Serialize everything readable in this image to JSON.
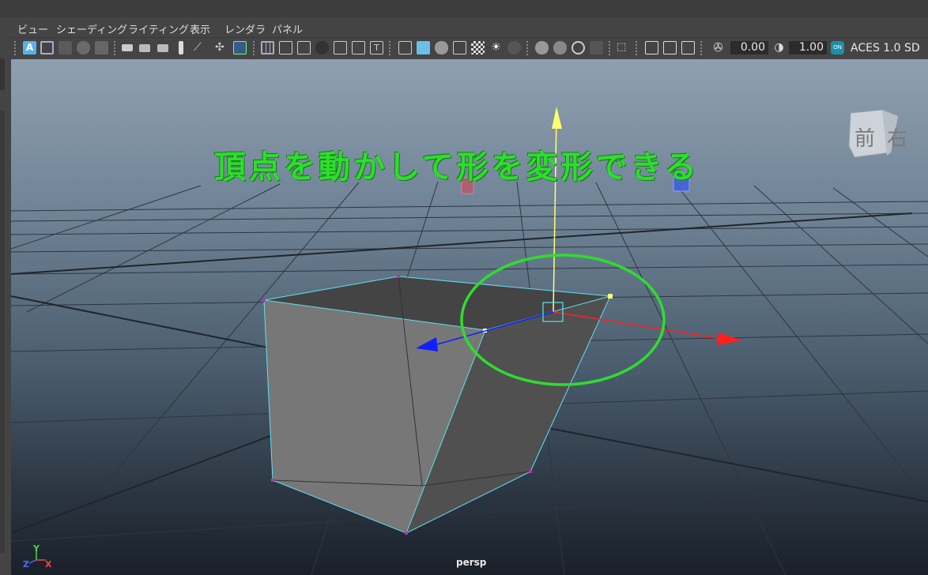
{
  "menu": {
    "view": "ビュー",
    "shading": "シェーディング",
    "lighting": "ライティング",
    "show": "表示",
    "renderer": "レンダラ",
    "panels": "パネル"
  },
  "toolbar": {
    "exposure_value": "0.00",
    "gamma_value": "1.00",
    "color_space": "ACES 1.0 SD"
  },
  "viewport": {
    "annotation": "頂点を動かして形を変形できる",
    "camera_name": "persp",
    "viewcube_front": "前",
    "viewcube_right": "右",
    "axis_labels": {
      "y": "Y",
      "x": "X",
      "z": "Z"
    }
  },
  "colors": {
    "annotation_green": "#2fdc2f",
    "selection_cyan": "#5fe0f0",
    "gizmo_x_red": "#ff2020",
    "gizmo_y_yellow": "#ffff70",
    "gizmo_z_blue": "#1020ff"
  },
  "icons": [
    "select-icon",
    "camera-icon",
    "grid-icon",
    "wireframe-icon",
    "shaded-icon",
    "light-icon",
    "isolate-icon",
    "xray-icon",
    "exposure-icon",
    "gamma-icon",
    "color-management-icon"
  ]
}
